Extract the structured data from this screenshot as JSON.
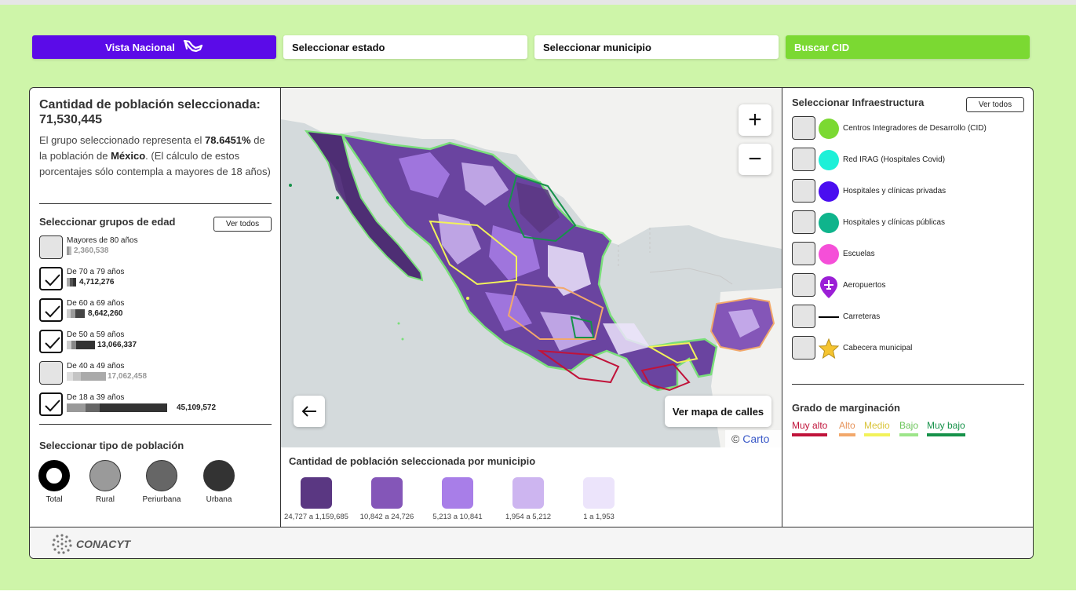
{
  "nav": {
    "national_label": "Vista Nacional",
    "state_label": "Seleccionar estado",
    "municipality_label": "Seleccionar municipio",
    "cid_label": "Buscar CID"
  },
  "population": {
    "title": "Cantidad de población seleccionada: 71,530,445",
    "desc_1": "El grupo seleccionado representa el ",
    "percent": "78.6451%",
    "desc_2": " de la población de ",
    "country": "México",
    "desc_3": ". (El cálculo de estos porcentajes sólo contempla a mayores de 18 años)"
  },
  "age_groups": {
    "title": "Seleccionar grupos de edad",
    "see_all": "Ver todos",
    "items": [
      {
        "label": "Mayores de 80 años",
        "value": "2,360,538",
        "checked": false
      },
      {
        "label": "De 70 a 79 años",
        "value": "4,712,276",
        "checked": true
      },
      {
        "label": "De 60 a 69 años",
        "value": "8,642,260",
        "checked": true
      },
      {
        "label": "De 50 a 59 años",
        "value": "13,066,337",
        "checked": true
      },
      {
        "label": "De 40 a 49 años",
        "value": "17,062,458",
        "checked": false
      },
      {
        "label": "De 18 a 39 años",
        "value": "45,109,572",
        "checked": true
      }
    ]
  },
  "population_type": {
    "title": "Seleccionar tipo de población",
    "items": [
      {
        "label": "Total",
        "color": "#000000",
        "selected": true
      },
      {
        "label": "Rural",
        "color": "#9a9a9a",
        "selected": false
      },
      {
        "label": "Periurbana",
        "color": "#666666",
        "selected": false
      },
      {
        "label": "Urbana",
        "color": "#333333",
        "selected": false
      }
    ]
  },
  "map": {
    "zoom_in": "+",
    "zoom_out": "−",
    "street_map_label": "Ver mapa de calles",
    "attribution_prefix": "© ",
    "attribution_link": "Carto",
    "legend_title": "Cantidad de población seleccionada por municipio",
    "legend": [
      {
        "label": "24,727 a 1,159,685",
        "color": "#5a3782"
      },
      {
        "label": "10,842 a 24,726",
        "color": "#8456b8"
      },
      {
        "label": "5,213 a 10,841",
        "color": "#a87ee8"
      },
      {
        "label": "1,954 a 5,212",
        "color": "#cdb5f0"
      },
      {
        "label": "1 a 1,953",
        "color": "#ece4fb"
      }
    ]
  },
  "infrastructure": {
    "title": "Seleccionar Infraestructura",
    "see_all": "Ver todos",
    "items": [
      {
        "label": "Centros Integradores de Desarrollo (CID)",
        "icon": "green-circle-icon",
        "color": "#7bd932"
      },
      {
        "label": "Red IRAG (Hospitales Covid)",
        "icon": "cyan-circle-icon",
        "color": "#1df0d8"
      },
      {
        "label": "Hospitales y clínicas privadas",
        "icon": "blue-circle-icon",
        "color": "#4a0ef0"
      },
      {
        "label": "Hospitales y clínicas públicas",
        "icon": "teal-circle-icon",
        "color": "#0fb48c"
      },
      {
        "label": "Escuelas",
        "icon": "pink-circle-icon",
        "color": "#f54fd8"
      },
      {
        "label": "Aeropuertos",
        "icon": "airport-pin-icon",
        "color": "#9b1fd6"
      },
      {
        "label": "Carreteras",
        "icon": "road-line-icon",
        "color": "#000000"
      },
      {
        "label": "Cabecera municipal",
        "icon": "star-icon",
        "color": "#f5c430"
      }
    ]
  },
  "marginalization": {
    "title": "Grado de marginación",
    "items": [
      {
        "label": "Muy alto",
        "color": "#c0133a"
      },
      {
        "label": "Alto",
        "color": "#f2a86b"
      },
      {
        "label": "Medio",
        "color": "#f2f25a"
      },
      {
        "label": "Bajo",
        "color": "#9de58a"
      },
      {
        "label": "Muy bajo",
        "color": "#16924a"
      }
    ]
  },
  "footer": {
    "logo_text": "CONACYT"
  }
}
